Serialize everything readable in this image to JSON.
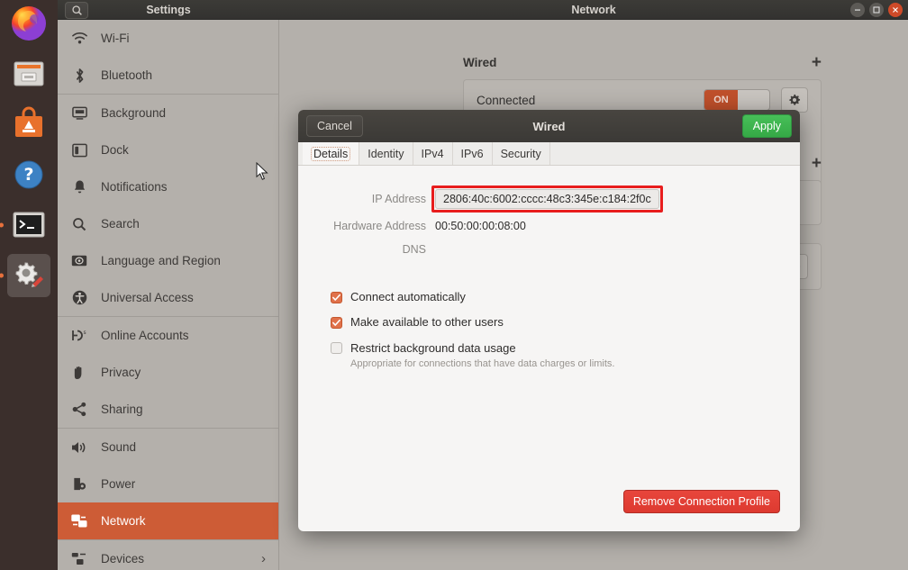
{
  "dock": {
    "items": [
      {
        "name": "firefox",
        "label": "Firefox Web Browser",
        "running": false,
        "active": false
      },
      {
        "name": "files",
        "label": "Files",
        "running": false,
        "active": false
      },
      {
        "name": "ubuntu-software",
        "label": "Ubuntu Software",
        "running": false,
        "active": false
      },
      {
        "name": "help",
        "label": "Help",
        "running": false,
        "active": false
      },
      {
        "name": "terminal",
        "label": "Terminal",
        "running": true,
        "active": false
      },
      {
        "name": "settings",
        "label": "Settings",
        "running": true,
        "active": true
      }
    ]
  },
  "window": {
    "sidebar_title": "Settings",
    "main_title": "Network",
    "controls": {
      "minimize": "–",
      "maximize": "□",
      "close": "×"
    }
  },
  "search": {
    "icon": "search-icon"
  },
  "sidebar": {
    "items": [
      {
        "label": "Wi-Fi",
        "icon": "wifi-icon",
        "selected": false,
        "chevron": false
      },
      {
        "label": "Bluetooth",
        "icon": "bluetooth-icon",
        "selected": false,
        "chevron": false
      },
      {
        "label": "Background",
        "icon": "background-icon",
        "selected": false,
        "chevron": false,
        "separator_before": true
      },
      {
        "label": "Dock",
        "icon": "dock-icon",
        "selected": false,
        "chevron": false
      },
      {
        "label": "Notifications",
        "icon": "bell-icon",
        "selected": false,
        "chevron": false
      },
      {
        "label": "Search",
        "icon": "search-icon",
        "selected": false,
        "chevron": false
      },
      {
        "label": "Language and Region",
        "icon": "language-icon",
        "selected": false,
        "chevron": false
      },
      {
        "label": "Universal Access",
        "icon": "accessibility-icon",
        "selected": false,
        "chevron": false
      },
      {
        "label": "Online Accounts",
        "icon": "online-accounts-icon",
        "selected": false,
        "chevron": false,
        "separator_before": true
      },
      {
        "label": "Privacy",
        "icon": "privacy-hand-icon",
        "selected": false,
        "chevron": false
      },
      {
        "label": "Sharing",
        "icon": "sharing-icon",
        "selected": false,
        "chevron": false
      },
      {
        "label": "Sound",
        "icon": "sound-icon",
        "selected": false,
        "chevron": false,
        "separator_before": true
      },
      {
        "label": "Power",
        "icon": "power-icon",
        "selected": false,
        "chevron": false
      },
      {
        "label": "Network",
        "icon": "network-icon",
        "selected": true,
        "chevron": false
      },
      {
        "label": "Devices",
        "icon": "devices-icon",
        "selected": false,
        "chevron": true,
        "separator_before": true
      }
    ]
  },
  "network_panel": {
    "wired": {
      "heading": "Wired",
      "add_label": "+",
      "status": "Connected",
      "toggle_state": "ON",
      "settings_icon": "gear-icon"
    },
    "second_section": {
      "add_label": "+",
      "settings_icon": "gear-icon"
    }
  },
  "dialog": {
    "cancel_label": "Cancel",
    "title": "Wired",
    "apply_label": "Apply",
    "tabs": [
      {
        "label": "Details",
        "active": true
      },
      {
        "label": "Identity",
        "active": false
      },
      {
        "label": "IPv4",
        "active": false
      },
      {
        "label": "IPv6",
        "active": false
      },
      {
        "label": "Security",
        "active": false
      }
    ],
    "fields": [
      {
        "label": "IP Address",
        "value": "2806:40c:6002:cccc:48c3:345e:c184:2f0c",
        "highlighted": true
      },
      {
        "label": "Hardware Address",
        "value": "00:50:00:00:08:00",
        "highlighted": false
      },
      {
        "label": "DNS",
        "value": "",
        "highlighted": false
      }
    ],
    "checkboxes": [
      {
        "label": "Connect automatically",
        "checked": true,
        "sublabel": ""
      },
      {
        "label": "Make available to other users",
        "checked": true,
        "sublabel": ""
      },
      {
        "label": "Restrict background data usage",
        "checked": false,
        "sublabel": "Appropriate for connections that have data charges or limits."
      }
    ],
    "remove_label": "Remove Connection Profile"
  },
  "colors": {
    "accent_orange": "#cd5c36",
    "apply_green": "#3eb34f",
    "danger_red": "#dd3a30",
    "highlight_red": "#e81d1d",
    "checkbox_orange": "#e0714a",
    "panel_grey": "#b4b0ab",
    "dialog_bg": "#f6f5f4"
  }
}
